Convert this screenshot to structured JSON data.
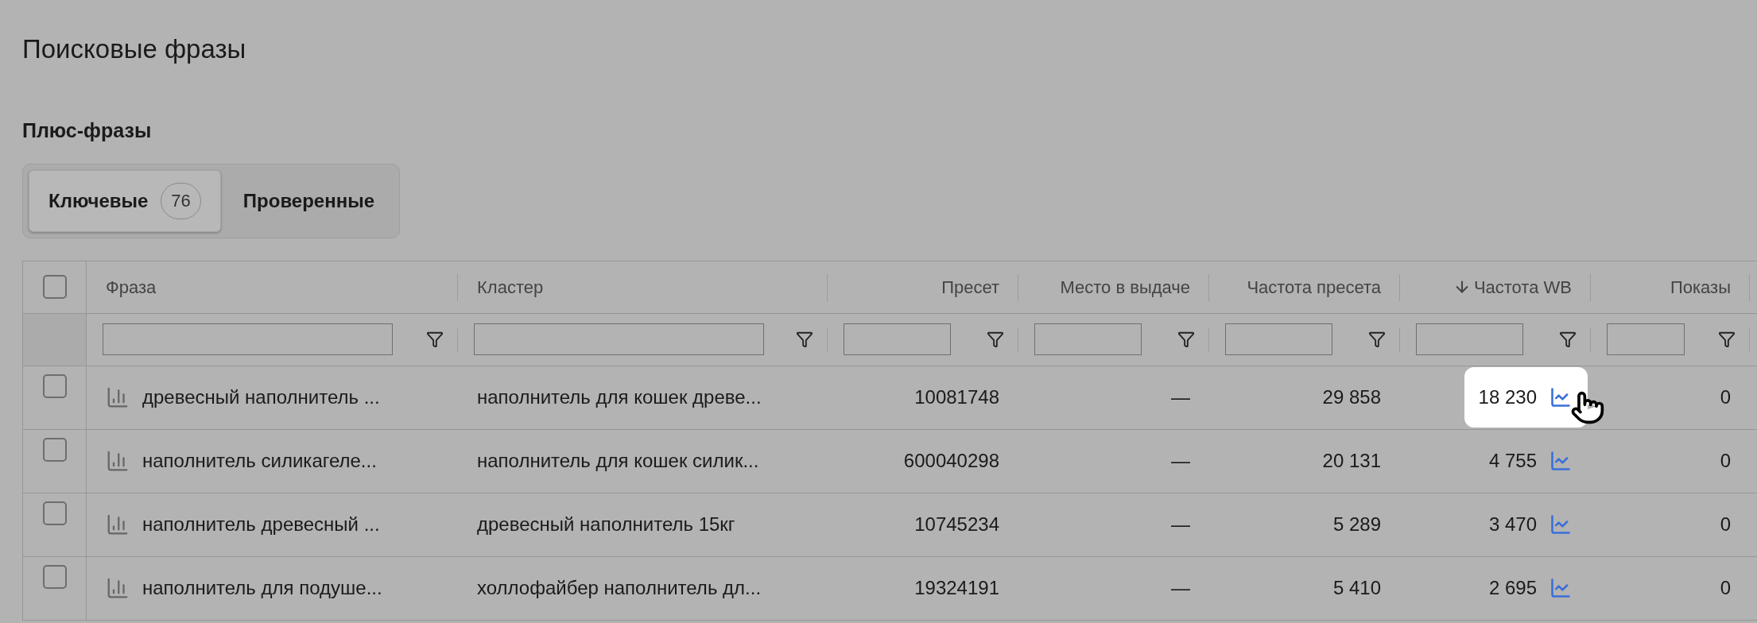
{
  "title": "Поисковые фразы",
  "section": "Плюс-фразы",
  "tabs": [
    {
      "label": "Ключевые",
      "count": "76",
      "selected": true
    },
    {
      "label": "Проверенные",
      "selected": false
    }
  ],
  "table": {
    "select_all": {
      "checked": false
    },
    "columns": [
      {
        "label": "Фраза",
        "sorted": false
      },
      {
        "label": "Кластер",
        "sorted": false
      },
      {
        "label": "Пресет",
        "sorted": false
      },
      {
        "label": "Место в выдаче",
        "sorted": false
      },
      {
        "label": "Частота пресета",
        "sorted": false
      },
      {
        "label": "Частота WB",
        "sorted": true
      },
      {
        "label": "Показы",
        "sorted": false
      }
    ],
    "rows": [
      {
        "checked": false,
        "phrase": "древесный наполнитель ...",
        "cluster": "наполнитель для кошек древе...",
        "preset": "10081748",
        "position": "—",
        "preset_freq": "29 858",
        "wb_freq": "18 230",
        "wb_highlighted": true,
        "impressions": "0"
      },
      {
        "checked": false,
        "phrase": "наполнитель силикагеле...",
        "cluster": "наполнитель для кошек силик...",
        "preset": "600040298",
        "position": "—",
        "preset_freq": "20 131",
        "wb_freq": "4 755",
        "wb_highlighted": false,
        "impressions": "0"
      },
      {
        "checked": false,
        "phrase": "наполнитель древесный ...",
        "cluster": "древесный наполнитель 15кг",
        "preset": "10745234",
        "position": "—",
        "preset_freq": "5 289",
        "wb_freq": "3 470",
        "wb_highlighted": false,
        "impressions": "0"
      },
      {
        "checked": false,
        "phrase": "наполнитель для подуше...",
        "cluster": "холлофайбер наполнитель дл...",
        "preset": "19324191",
        "position": "—",
        "preset_freq": "5 410",
        "wb_freq": "2 695",
        "wb_highlighted": false,
        "impressions": "0"
      }
    ]
  }
}
